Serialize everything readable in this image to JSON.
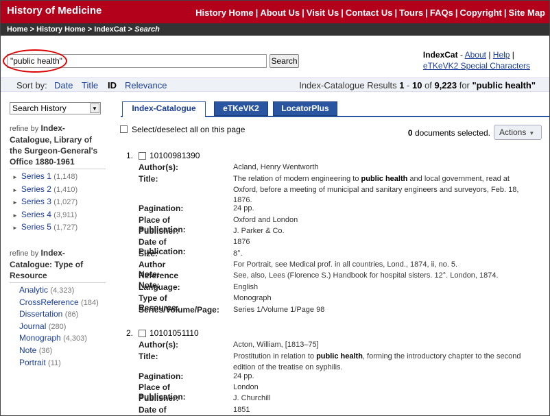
{
  "site": {
    "brand": "History of Medicine",
    "nav": [
      "History Home",
      "About Us",
      "Visit Us",
      "Contact Us",
      "Tours",
      "FAQs",
      "Copyright",
      "Site Map"
    ]
  },
  "breadcrumb": {
    "home": "Home",
    "history_home": "History Home",
    "indexcat": "IndexCat",
    "current": "Search"
  },
  "search": {
    "value": "\"public health\"",
    "button": "Search"
  },
  "links": {
    "title": "IndexCat",
    "about": "About",
    "help": "Help",
    "special": "eTKeVK2 Special Characters"
  },
  "sort": {
    "label": "Sort by:",
    "options": [
      {
        "label": "Date",
        "active": false
      },
      {
        "label": "Title",
        "active": false
      },
      {
        "label": "ID",
        "active": true
      },
      {
        "label": "Relevance",
        "active": false
      }
    ]
  },
  "results": {
    "source": "Index-Catalogue Results",
    "from": "1",
    "to": "10",
    "total": "9,223",
    "query": "\"public health\""
  },
  "sidebar": {
    "history_select": "Search History",
    "refine_by": "refine by",
    "group1": {
      "title": "Index-Catalogue, Library of the Surgeon-General's Office 1880-1961",
      "items": [
        {
          "label": "Series 1",
          "count": "(1,148)"
        },
        {
          "label": "Series 2",
          "count": "(1,410)"
        },
        {
          "label": "Series 3",
          "count": "(1,027)"
        },
        {
          "label": "Series 4",
          "count": "(3,911)"
        },
        {
          "label": "Series 5",
          "count": "(1,727)"
        }
      ]
    },
    "group2": {
      "title": "Index-Catalogue: Type of Resource",
      "items": [
        {
          "label": "Analytic",
          "count": "(4,323)"
        },
        {
          "label": "CrossReference",
          "count": "(184)"
        },
        {
          "label": "Dissertation",
          "count": "(86)"
        },
        {
          "label": "Journal",
          "count": "(280)"
        },
        {
          "label": "Monograph",
          "count": "(4,303)"
        },
        {
          "label": "Note",
          "count": "(36)"
        },
        {
          "label": "Portrait",
          "count": "(11)"
        }
      ]
    }
  },
  "tabs": [
    "Index-Catalogue",
    "eTKeVK2",
    "LocatorPlus"
  ],
  "selection": {
    "select_all": "Select/deselect all on this page",
    "count": "0",
    "label": "documents selected.",
    "actions": "Actions"
  },
  "records": [
    {
      "num": "1.",
      "id": "10100981390",
      "fields": [
        {
          "label": "Author(s):",
          "value": "Acland, Henry Wentworth"
        },
        {
          "label": "Title:",
          "pre": "The relation of modern engineering to ",
          "em": "public health",
          "post": " and local government, read at Oxford, before a meeting of municipal and sanitary engineers and surveyors, Feb. 18, 1876."
        },
        {
          "label": "Pagination:",
          "value": "24 pp."
        },
        {
          "label": "Place of Publication:",
          "value": "Oxford and London"
        },
        {
          "label": "Publisher:",
          "value": "J. Parker & Co."
        },
        {
          "label": "Date of Publication:",
          "value": "1876"
        },
        {
          "label": "Size:",
          "value": "8°."
        },
        {
          "label": "Author Note:",
          "value": "For Portrait, see Medical prof. in all countries, Lond., 1874, ii, no. 5."
        },
        {
          "label": "Reference Note:",
          "value": "See, also, Lees (Florence S.) Handbook for hospital sisters. 12°. London, 1874."
        },
        {
          "label": "Language:",
          "value": "English"
        },
        {
          "label": "Type of Resource:",
          "value": "Monograph"
        },
        {
          "label": "Series/Volume/Page:",
          "value": "Series 1/Volume 1/Page 98"
        }
      ]
    },
    {
      "num": "2.",
      "id": "10101051110",
      "fields": [
        {
          "label": "Author(s):",
          "value": "Acton, William, [1813–75]"
        },
        {
          "label": "Title:",
          "pre": "Prostitution in relation to ",
          "em": "public health",
          "post": ", forming the introductory chapter to the second edition of the treatise on syphilis."
        },
        {
          "label": "Pagination:",
          "value": "24 pp."
        },
        {
          "label": "Place of Publication:",
          "value": "London"
        },
        {
          "label": "Publisher:",
          "value": "J. Churchill"
        },
        {
          "label": "Date of Publication:",
          "value": "1851"
        }
      ]
    }
  ]
}
